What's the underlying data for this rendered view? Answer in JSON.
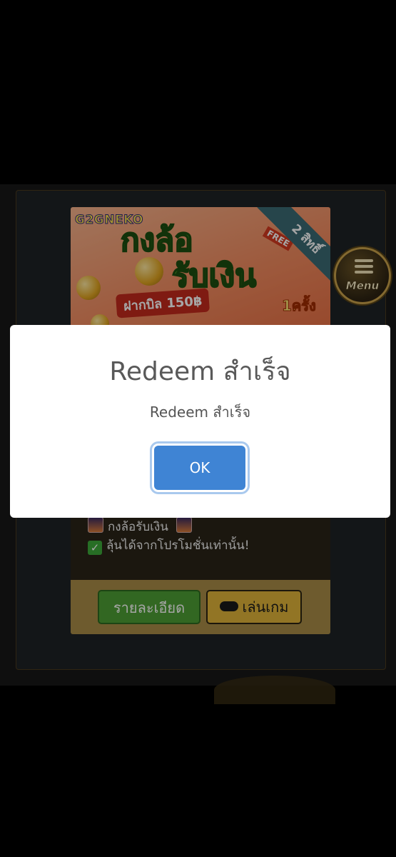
{
  "promo": {
    "brand": "G2GNEKO",
    "headline_line1": "กงล้อ",
    "headline_line2": "รับเงิน",
    "deposit_text": "ฝากบิล 150฿",
    "times_text": "1ครั้ง",
    "ribbon_text": "2 สิทธิ์",
    "free_tag": "FREE",
    "line1": "กงล้อรับเงิน",
    "line2": "ลุ้นได้จากโปรโมชั่นเท่านั้น!",
    "detail_button": "รายละเอียด",
    "play_button": "เล่นเกม"
  },
  "menu": {
    "label": "Menu"
  },
  "dialog": {
    "title": "Redeem สำเร็จ",
    "text": "Redeem สำเร็จ",
    "ok_label": "OK"
  },
  "colors": {
    "ok_button": "#3f84d4",
    "detail_button": "#4e9e35",
    "play_button": "#e0b43a"
  },
  "icons": [
    "menu-icon",
    "image-emoji-icon",
    "checkmark-icon",
    "gamepad-icon"
  ]
}
